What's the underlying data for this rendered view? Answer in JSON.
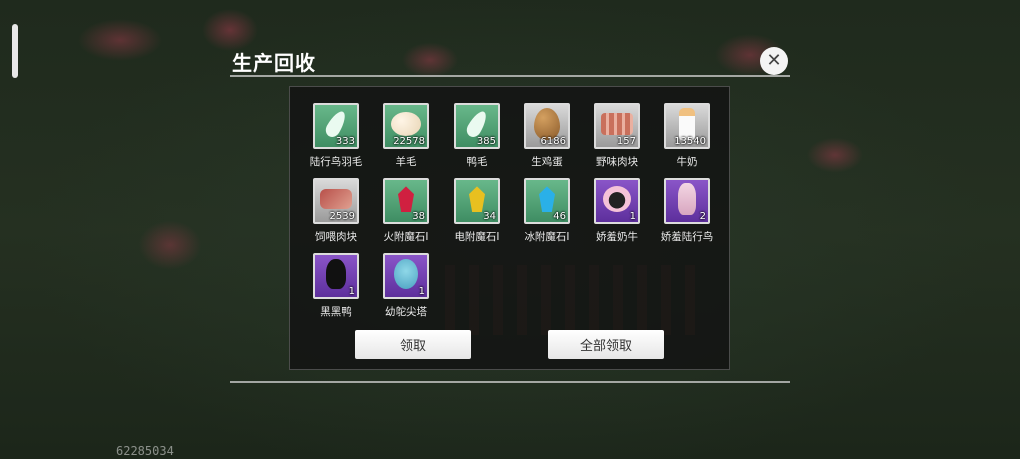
{
  "dialog": {
    "title": "生产回收",
    "close_icon": "close-icon",
    "claim_label": "领取",
    "claim_all_label": "全部领取"
  },
  "items": [
    {
      "name": "陆行鸟羽毛",
      "count": "333",
      "rarity": "green",
      "icon": "feather-icon"
    },
    {
      "name": "羊毛",
      "count": "22578",
      "rarity": "green",
      "icon": "wool-icon"
    },
    {
      "name": "鸭毛",
      "count": "385",
      "rarity": "green",
      "icon": "feather-icon"
    },
    {
      "name": "生鸡蛋",
      "count": "6186",
      "rarity": "gray",
      "icon": "egg-icon"
    },
    {
      "name": "野味肉块",
      "count": "157",
      "rarity": "gray",
      "icon": "meat-icon"
    },
    {
      "name": "牛奶",
      "count": "13540",
      "rarity": "gray",
      "icon": "milk-icon"
    },
    {
      "name": "饲喂肉块",
      "count": "2539",
      "rarity": "gray",
      "icon": "steak-icon"
    },
    {
      "name": "火附魔石I",
      "count": "38",
      "rarity": "green",
      "icon": "red-gem-icon"
    },
    {
      "name": "电附魔石I",
      "count": "34",
      "rarity": "green",
      "icon": "yellow-gem-icon"
    },
    {
      "name": "冰附魔石I",
      "count": "46",
      "rarity": "green",
      "icon": "blue-gem-icon"
    },
    {
      "name": "娇羞奶牛",
      "count": "1",
      "rarity": "purple",
      "icon": "cow-icon"
    },
    {
      "name": "娇羞陆行鸟",
      "count": "2",
      "rarity": "purple",
      "icon": "bird-icon"
    },
    {
      "name": "黑黑鸭",
      "count": "1",
      "rarity": "purple",
      "icon": "black-duck-icon"
    },
    {
      "name": "幼鸵尖塔",
      "count": "1",
      "rarity": "purple",
      "icon": "chick-icon"
    }
  ],
  "footer": {
    "uid": "62285034"
  },
  "colors": {
    "green_slot": "#4f9f72",
    "purple_slot": "#7440b4",
    "gray_slot": "#bdbdbd"
  }
}
